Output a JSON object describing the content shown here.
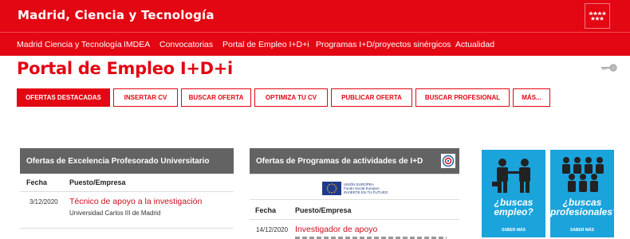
{
  "header": {
    "brand": "Madrid, Ciencia y Tecnología",
    "logo_stars": "★★★★\n★★★"
  },
  "nav": {
    "items": [
      "Madrid Ciencia y Tecnología",
      "IMDEA",
      "Convocatorias",
      "Portal de Empleo I+D+i",
      "Programas I+D/proyectos sinérgicos",
      "Actualidad"
    ]
  },
  "page": {
    "title": "Portal de Empleo I+D+i"
  },
  "tabs": [
    "OFERTAS DESTACADAS",
    "INSERTAR CV",
    "BUSCAR OFERTA",
    "OPTIMIZA TU CV",
    "PUBLICAR OFERTA",
    "BUSCAR PROFESIONAL",
    "MÁS..."
  ],
  "panel_left": {
    "title": "Ofertas de Excelencia Profesorado Universitario",
    "col_date": "Fecha",
    "col_job": "Puesto/Empresa",
    "rows": [
      {
        "date": "3/12/2020",
        "job": "Técnico de apoyo a la investigación",
        "org": "Universidad Carlos III de Madrid"
      }
    ]
  },
  "panel_right": {
    "title": "Ofertas de Programas de actividades de I+D",
    "eu_text": "UNIÓN EUROPEA\nFondo Social Europeo\nINVIERTE EN TU FUTURO",
    "col_date": "Fecha",
    "col_job": "Puesto/Empresa",
    "rows": [
      {
        "date": "14/12/2020",
        "job": "Investigador de apoyo"
      }
    ]
  },
  "promos": [
    {
      "text": "¿buscas empleo?",
      "more": "SABER MÁS"
    },
    {
      "text": "¿buscas profesionales?",
      "more": "SABER MÁS"
    }
  ],
  "colors": {
    "brand_red": "#e30613",
    "panel_gray": "#636363",
    "promo_blue": "#1ba3dc"
  }
}
